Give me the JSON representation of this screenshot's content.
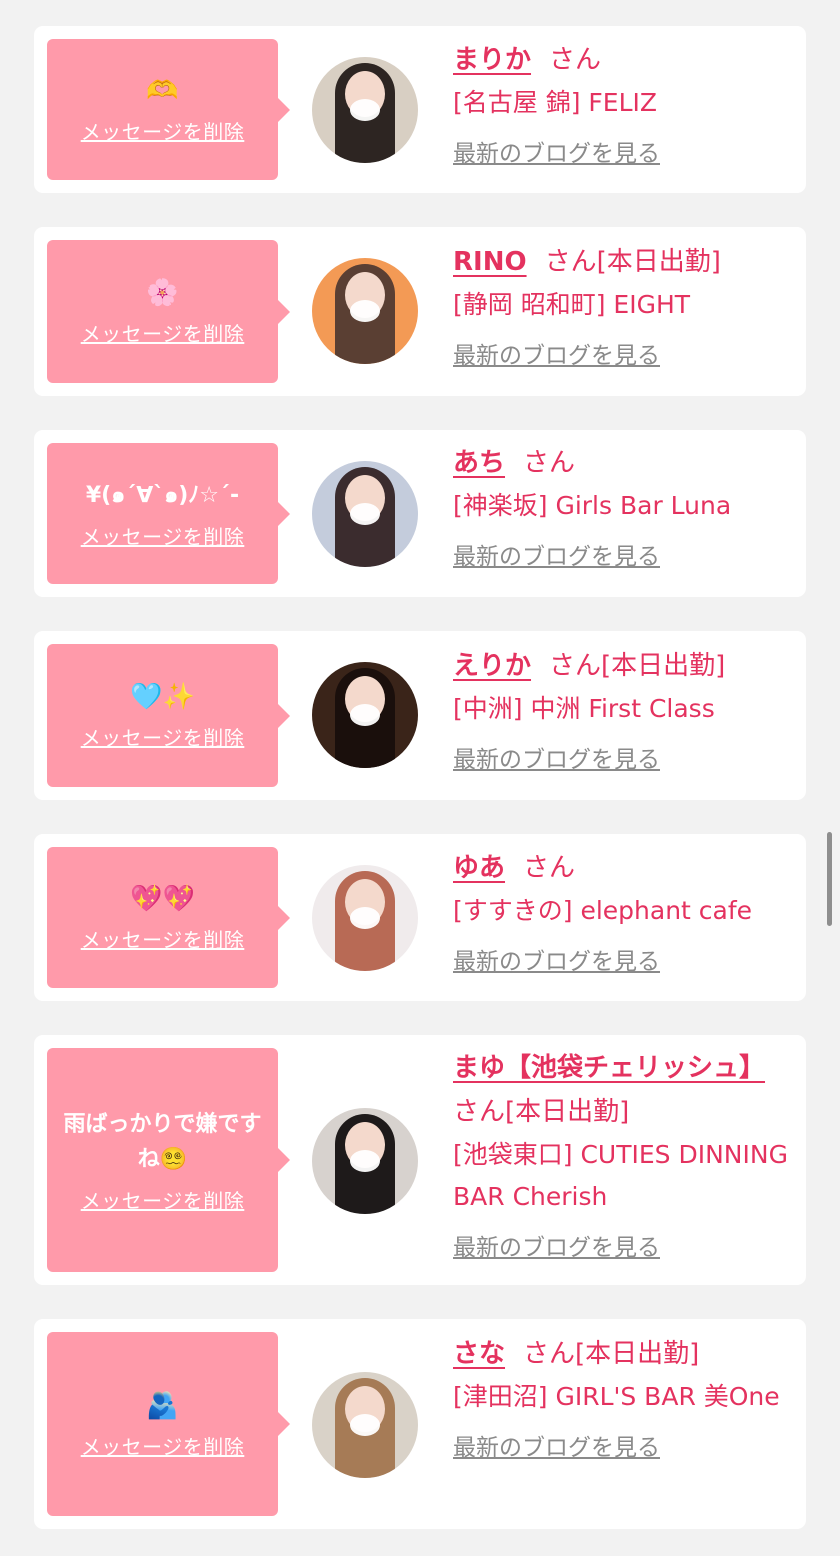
{
  "delete_label": "メッセージを削除",
  "blog_label": "最新のブログを見る",
  "cards": [
    {
      "message": "🫶",
      "emoji": true,
      "name": "まりか",
      "suffix": "さん",
      "shop": "[名古屋 錦] FELIZ",
      "avatar_icon": "profile-photo",
      "bg": "#d8cfc3",
      "hair": "#2d2522"
    },
    {
      "message": "🌸",
      "emoji": true,
      "name": "RINO",
      "suffix": "さん[本日出勤]",
      "shop": "[静岡 昭和町] EIGHT",
      "avatar_icon": "profile-photo",
      "bg": "#f39a55",
      "hair": "#5a3f33"
    },
    {
      "message": "¥(๑´∀`๑)ﾉ☆´-",
      "emoji": false,
      "name": "あち",
      "suffix": "さん",
      "shop": "[神楽坂] Girls Bar Luna",
      "avatar_icon": "profile-photo",
      "bg": "#c4ccdc",
      "hair": "#3b2c2e"
    },
    {
      "message": "🩵✨",
      "emoji": true,
      "name": "えりか",
      "suffix": "さん[本日出勤]",
      "shop": "[中洲] 中洲 First Class",
      "avatar_icon": "profile-photo",
      "bg": "#3a2419",
      "hair": "#1a0f0c"
    },
    {
      "message": "💖💖",
      "emoji": true,
      "name": "ゆあ",
      "suffix": "さん",
      "shop": "[すすきの] elephant cafe",
      "avatar_icon": "profile-photo",
      "bg": "#f0ebec",
      "hair": "#b86a55"
    },
    {
      "message": "雨ばっかりで嫌ですね😵‍💫",
      "emoji": false,
      "name": "まゆ【池袋チェリッシュ】",
      "suffix": "さん[本日出勤]",
      "shop": "[池袋東口] CUTIES DINNING BAR Cherish",
      "avatar_icon": "profile-photo",
      "bg": "#d7d2ce",
      "hair": "#1e1a1a"
    },
    {
      "message": "🫂",
      "emoji": true,
      "name": "さな",
      "suffix": "さん[本日出勤]",
      "shop": "[津田沼] GIRL'S BAR 美One",
      "avatar_icon": "profile-photo",
      "bg": "#d9d2c8",
      "hair": "#a67b56"
    }
  ]
}
